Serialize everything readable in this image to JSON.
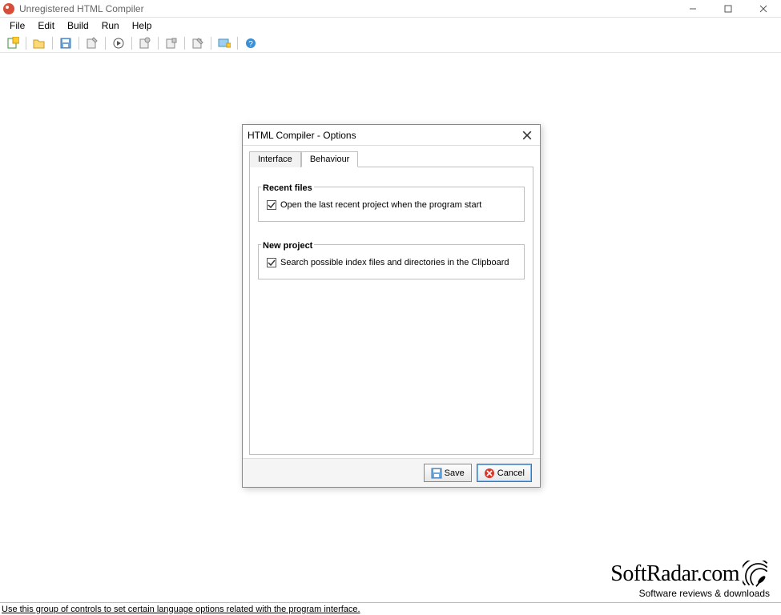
{
  "window": {
    "title": "Unregistered HTML Compiler"
  },
  "menubar": {
    "file": "File",
    "edit": "Edit",
    "build": "Build",
    "run": "Run",
    "help": "Help"
  },
  "statusbar": {
    "text": "Use this group of controls to set certain language options related with the program interface."
  },
  "dialog": {
    "title": "HTML Compiler - Options",
    "tabs": {
      "interface": "Interface",
      "behaviour": "Behaviour"
    },
    "groups": {
      "recent_files": {
        "title": "Recent files",
        "checkbox_label": "Open the last recent project when the program start",
        "checked": true
      },
      "new_project": {
        "title": "New project",
        "checkbox_label": "Search possible index files and directories in the Clipboard",
        "checked": true
      }
    },
    "buttons": {
      "save": "Save",
      "cancel": "Cancel"
    }
  },
  "watermark": {
    "line1": "SoftRadar.com",
    "line2": "Software reviews & downloads"
  }
}
